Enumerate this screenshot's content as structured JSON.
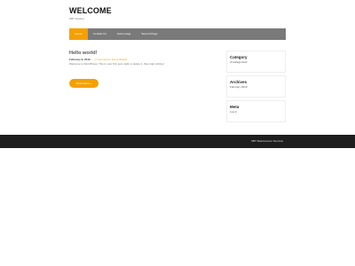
{
  "site": {
    "title": "WELCOME",
    "tagline": "SBT Hosting"
  },
  "nav": {
    "items": [
      {
        "label": "Home"
      },
      {
        "label": "Contact Us"
      },
      {
        "label": "Home page"
      },
      {
        "label": "Second Page"
      }
    ],
    "active_index": 0
  },
  "post": {
    "title": "Hello world!",
    "date": "February 9, 2019",
    "separator": "|",
    "comments": "1 Comment to this (untitled)",
    "excerpt": "Welcome to WordPress. This is your first post. Edit or delete it, then start writing!",
    "read_more_label": "Read More »"
  },
  "sidebar": {
    "widgets": [
      {
        "title": "Category",
        "links": [
          "Uncategorized"
        ]
      },
      {
        "title": "Archives",
        "links": [
          "February 2019"
        ]
      },
      {
        "title": "Meta",
        "links": [
          "Log in"
        ]
      }
    ]
  },
  "footer": {
    "text": "SBT Maintenance Services"
  },
  "colors": {
    "accent": "#f5a000",
    "nav_bg": "#7a7a7a",
    "footer_bg": "#1e1e1e"
  }
}
